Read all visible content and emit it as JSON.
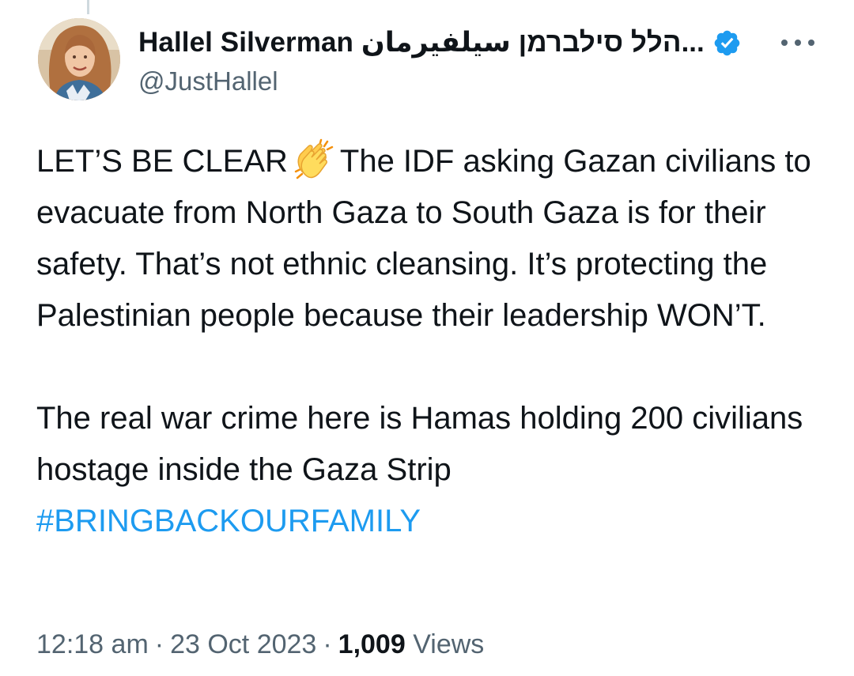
{
  "author": {
    "display_name": "Hallel Silverman הלל סילברמן سيلفيرمان...",
    "handle": "@JustHallel",
    "verified": true,
    "avatar_icon": "profile-photo"
  },
  "tweet": {
    "line1_before_emoji": "LET’S BE CLEAR",
    "emoji": "clapping-hands-emoji",
    "paragraph1_after_emoji": "The IDF asking Gazan civilians to evacuate from North Gaza to South Gaza is for their safety. That’s not ethnic cleansing. It’s protecting the Palestinian people because their leadership WON’T.",
    "paragraph2": "The real war crime here is Hamas holding 200 civilians hostage inside the Gaza Strip",
    "hashtag": "#BRINGBACKOURFAMILY"
  },
  "meta": {
    "time": "12:18 am",
    "separator": "·",
    "date": "23 Oct 2023",
    "views_count": "1,009",
    "views_label": "Views"
  },
  "colors": {
    "text": "#0f1419",
    "secondary": "#536471",
    "link": "#1d9bf0",
    "verified": "#1d9bf0"
  }
}
